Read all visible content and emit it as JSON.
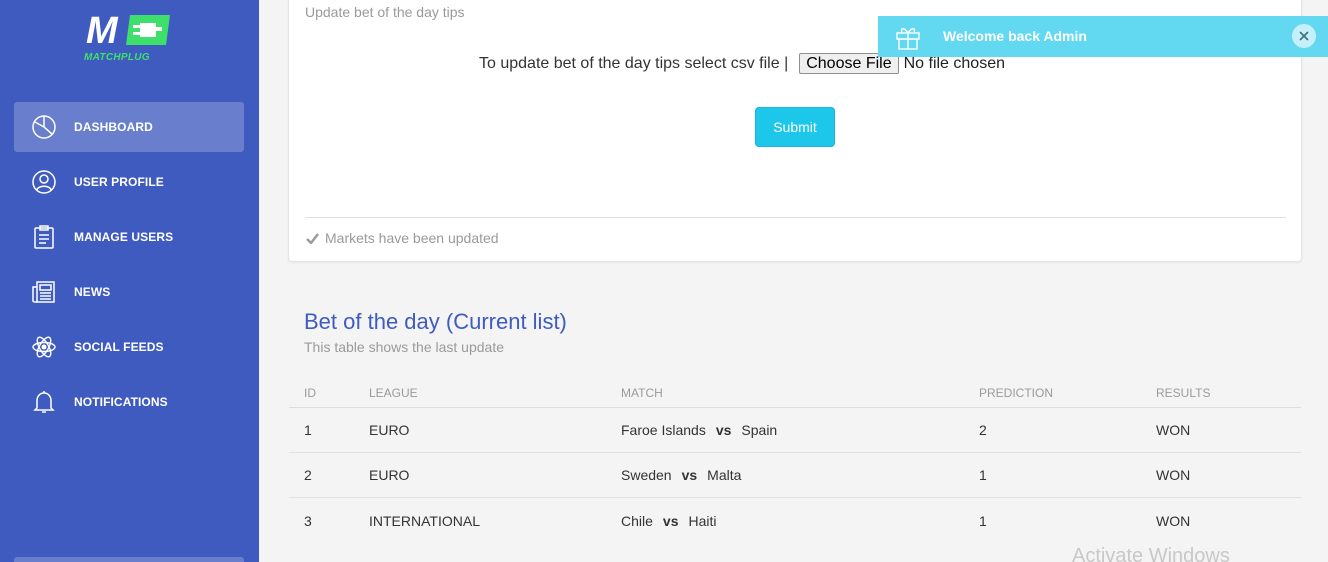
{
  "brand": {
    "logo_letter": "M",
    "logo_text": "MATCHPLUG",
    "accent_green": "#3ce06b",
    "primary_blue": "#3f5bbf"
  },
  "sidebar": {
    "items": [
      {
        "label": "DASHBOARD",
        "icon": "pie-chart-icon",
        "active": true
      },
      {
        "label": "USER PROFILE",
        "icon": "user-icon",
        "active": false
      },
      {
        "label": "MANAGE USERS",
        "icon": "clipboard-icon",
        "active": false
      },
      {
        "label": "NEWS",
        "icon": "newspaper-icon",
        "active": false
      },
      {
        "label": "SOCIAL FEEDS",
        "icon": "atom-icon",
        "active": false
      },
      {
        "label": "NOTIFICATIONS",
        "icon": "bell-icon",
        "active": false
      }
    ]
  },
  "upload_card": {
    "subtitle": "Update bet of the day tips",
    "label": "To update bet of the day tips select csv file |",
    "file_button": "Choose File",
    "file_status": "No file chosen",
    "submit_label": "Submit",
    "footer_text": "Markets have been updated"
  },
  "bet_table": {
    "title": "Bet of the day (Current list)",
    "subtitle": "This table shows the last update",
    "columns": [
      "ID",
      "LEAGUE",
      "MATCH",
      "PREDICTION",
      "RESULTS"
    ],
    "vs_label": "vs",
    "rows": [
      {
        "id": "1",
        "league": "EURO",
        "home": "Faroe Islands",
        "away": "Spain",
        "prediction": "2",
        "result": "WON"
      },
      {
        "id": "2",
        "league": "EURO",
        "home": "Sweden",
        "away": "Malta",
        "prediction": "1",
        "result": "WON"
      },
      {
        "id": "3",
        "league": "INTERNATIONAL",
        "home": "Chile",
        "away": "Haiti",
        "prediction": "1",
        "result": "WON"
      }
    ]
  },
  "toast": {
    "prefix": "Welcome back ",
    "name": "Admin",
    "icon": "gift-icon",
    "close_icon": "close-icon",
    "color": "#63d8f1"
  },
  "watermark": "Activate Windows"
}
